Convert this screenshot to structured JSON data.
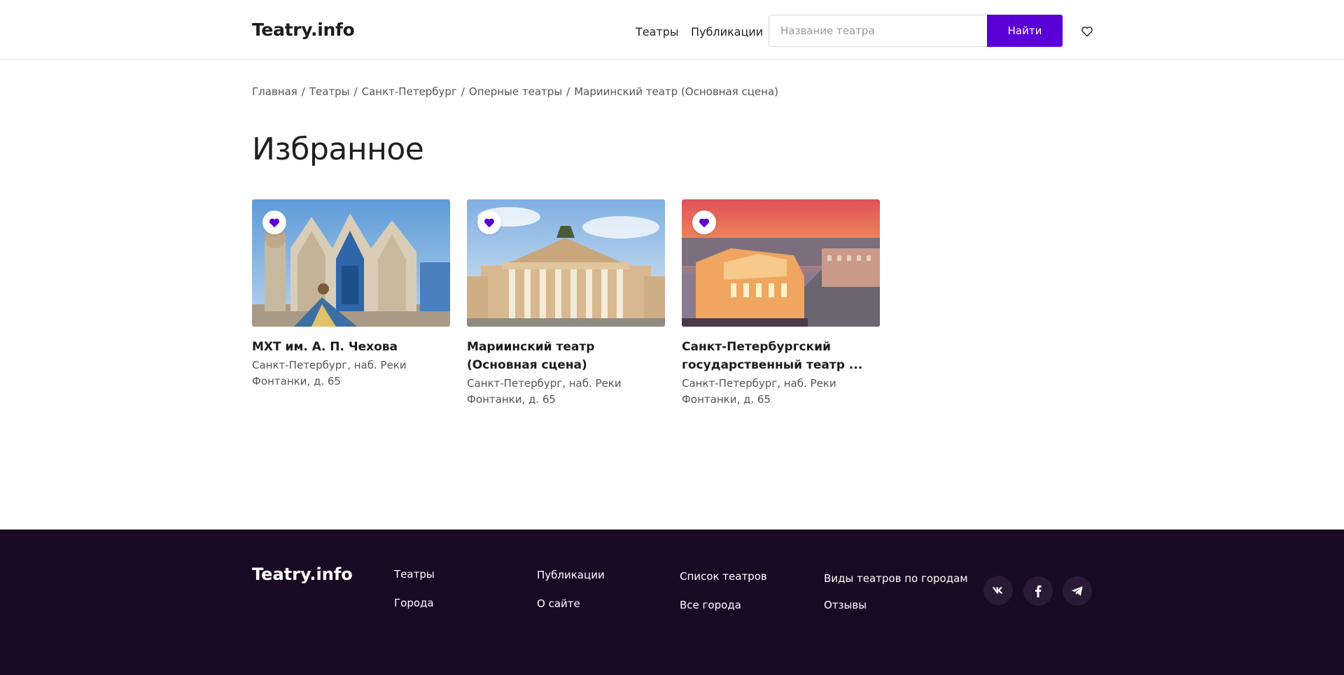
{
  "header": {
    "logo": "Teatry.info",
    "nav": {
      "theaters": "Театры",
      "publications": "Публикации"
    },
    "search": {
      "placeholder": "Название театра",
      "button": "Найти"
    },
    "favorites_icon": "heart-outline-icon"
  },
  "breadcrumb": [
    "Главная",
    "Театры",
    "Санкт-Петербург",
    "Оперные театры",
    "Мариинский театр (Основная сцена)"
  ],
  "page_title": "Избранное",
  "cards": [
    {
      "title": "МХТ им. А. П. Чехова",
      "address": "Санкт-Петербург, наб. Реки Фонтанки, д. 65",
      "favorite": true
    },
    {
      "title": "Мариинский театр (Основная сцена)",
      "address": "Санкт-Петербург, наб. Реки Фонтанки, д. 65",
      "favorite": true
    },
    {
      "title": "Санкт-Петербургский государственный театр ...",
      "address": "Санкт-Петербург, наб. Реки Фонтанки, д. 65",
      "favorite": true
    }
  ],
  "footer": {
    "logo": "Teatry.info",
    "col1": [
      "Театры",
      "Города"
    ],
    "col2": [
      "Публикации",
      "О сайте"
    ],
    "col3": [
      "Список театров",
      "Все города"
    ],
    "col4": [
      "Виды театров по городам",
      "Отзывы"
    ],
    "social": [
      "vk-icon",
      "facebook-icon",
      "telegram-icon"
    ]
  },
  "colors": {
    "accent": "#5a00d6",
    "footer_bg": "#190a24",
    "text": "#1f1f1f",
    "muted": "#555555"
  }
}
